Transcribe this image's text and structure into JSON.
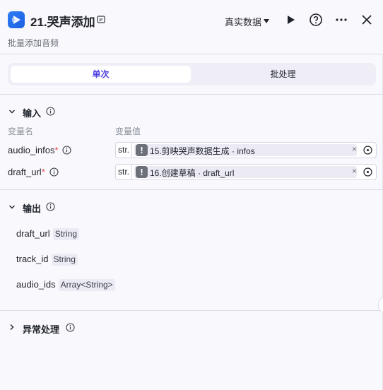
{
  "header": {
    "title": "21.哭声添加",
    "subtitle": "批量添加音频",
    "data_select": "真实数据",
    "icons": [
      "play-icon",
      "help-icon",
      "more-icon",
      "close-icon"
    ]
  },
  "tabs": [
    {
      "label": "单次",
      "active": true
    },
    {
      "label": "批处理",
      "active": false
    }
  ],
  "inputs": {
    "title": "输入",
    "col_name": "变量名",
    "col_value": "变量值",
    "rows": [
      {
        "name": "audio_infos",
        "required": "*",
        "type": "str.",
        "ref": "15.剪映哭声数据生成 · infos"
      },
      {
        "name": "draft_url",
        "required": "*",
        "type": "str.",
        "ref": "16.创建草稿 · draft_url"
      }
    ]
  },
  "outputs": {
    "title": "输出",
    "rows": [
      {
        "name": "draft_url",
        "type": "String"
      },
      {
        "name": "track_id",
        "type": "String"
      },
      {
        "name": "audio_ids",
        "type": "Array<String>"
      }
    ]
  },
  "exception": {
    "title": "异常处理"
  },
  "colors": {
    "accent": "#4e40e5",
    "logo": "#2f7df6",
    "required": "#e5484d"
  }
}
